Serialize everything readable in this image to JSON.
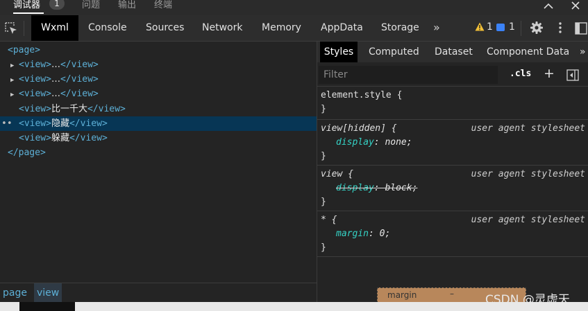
{
  "top_tabs": [
    "调试器",
    "问题",
    "输出",
    "终端"
  ],
  "top_badge": "1",
  "toolbar": {
    "tabs": [
      "Wxml",
      "Console",
      "Sources",
      "Network",
      "Memory",
      "AppData",
      "Storage"
    ],
    "active_tab": "Wxml",
    "more": "»",
    "warnings": "1",
    "messages": "1"
  },
  "dom_tree": {
    "page_open": "<page>",
    "page_close": "</page>",
    "collapsed_open": "<view>",
    "collapsed_ellipsis": "…",
    "collapsed_close": "</view>",
    "view_open": "<view>",
    "view_close": "</view>",
    "texts": [
      "比一千大",
      "隐藏",
      "躲藏"
    ],
    "selected_index": 1,
    "selected_marker": "••"
  },
  "breadcrumb": [
    "page",
    "view"
  ],
  "styles": {
    "tabs": [
      "Styles",
      "Computed",
      "Dataset",
      "Component Data"
    ],
    "more": "»",
    "filter_placeholder": "Filter",
    "cls_label": ".cls",
    "add_label": "+",
    "rules": [
      {
        "selector": "element.style {",
        "origin": "",
        "props": [],
        "close": "}"
      },
      {
        "selector": "view[hidden] {",
        "origin": "user agent stylesheet",
        "props": [
          {
            "name": "display",
            "value": "none;",
            "struck": false
          }
        ],
        "close": "}"
      },
      {
        "selector": "view {",
        "origin": "user agent stylesheet",
        "props": [
          {
            "name": "display",
            "value": "block;",
            "struck": true
          }
        ],
        "close": "}"
      },
      {
        "selector": "* {",
        "origin": "user agent stylesheet",
        "props": [
          {
            "name": "margin",
            "value": "0;",
            "struck": false
          }
        ],
        "close": "}"
      }
    ]
  },
  "box_model": {
    "label": "margin",
    "value": "–"
  },
  "watermark": "CSDN @灵虚天",
  "colors": {
    "accent": "#5db0d7",
    "selection": "#073655",
    "warning": "#f2c037",
    "prop": "#35d4c7"
  }
}
